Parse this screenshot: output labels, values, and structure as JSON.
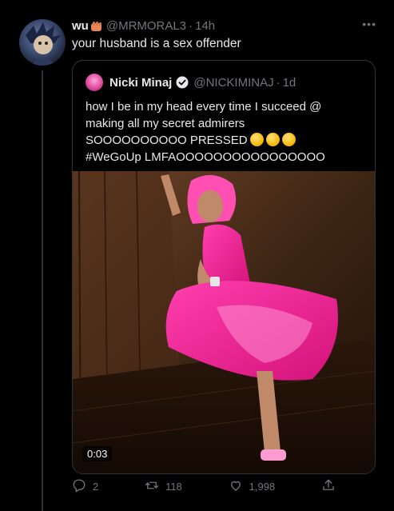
{
  "tweet": {
    "display_name": "wu",
    "handle": "@MRMORAL3",
    "dot": "·",
    "time": "14h",
    "more_icon": "more-horizontal-icon",
    "text": "your husband is a sex offender"
  },
  "quoted_tweet": {
    "display_name": "Nicki Minaj",
    "verified_icon": "verified-badge-icon",
    "handle": "@NICKIMINAJ",
    "dot": "·",
    "time": "1d",
    "text_line1": "how I be in my head every time I succeed @",
    "text_line2": "making all my secret admirers",
    "text_line3": "SOOOOOOOOOO PRESSED",
    "text_line4": "#WeGoUp LMFAOOOOOOOOOOOOOOOO",
    "video_time": "0:03"
  },
  "actions": {
    "replies": "2",
    "retweets": "118",
    "likes": "1,998"
  },
  "colors": {
    "background": "#000000",
    "text": "#e7e9ea",
    "muted": "#71767b",
    "border": "#2f3336",
    "verified": "#1d9bf0",
    "pink": "#ff2fa0"
  }
}
